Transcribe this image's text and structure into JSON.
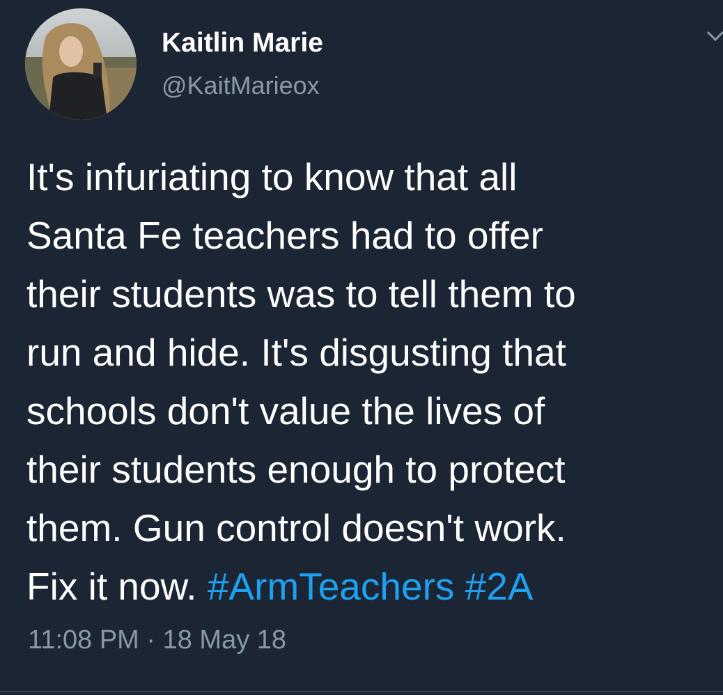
{
  "tweet": {
    "author": {
      "display_name": "Kaitlin Marie",
      "handle": "@KaitMarieox"
    },
    "text_lines": [
      "It's infuriating to know that all",
      "Santa Fe teachers had to offer",
      "their students was to tell them to",
      "run and hide. It's disgusting that",
      "schools don't value the lives of",
      "their students enough to protect",
      "them. Gun control doesn't work.",
      "Fix it now. "
    ],
    "hashtags": [
      "#ArmTeachers",
      "#2A"
    ],
    "timestamp": "11:08 PM · 18 May 18"
  },
  "icons": {
    "menu": "chevron-down-icon"
  },
  "colors": {
    "background": "#1c2533",
    "text": "#ffffff",
    "secondary_text": "#8899a6",
    "hashtag": "#1da1f2",
    "divider": "#38444d"
  }
}
